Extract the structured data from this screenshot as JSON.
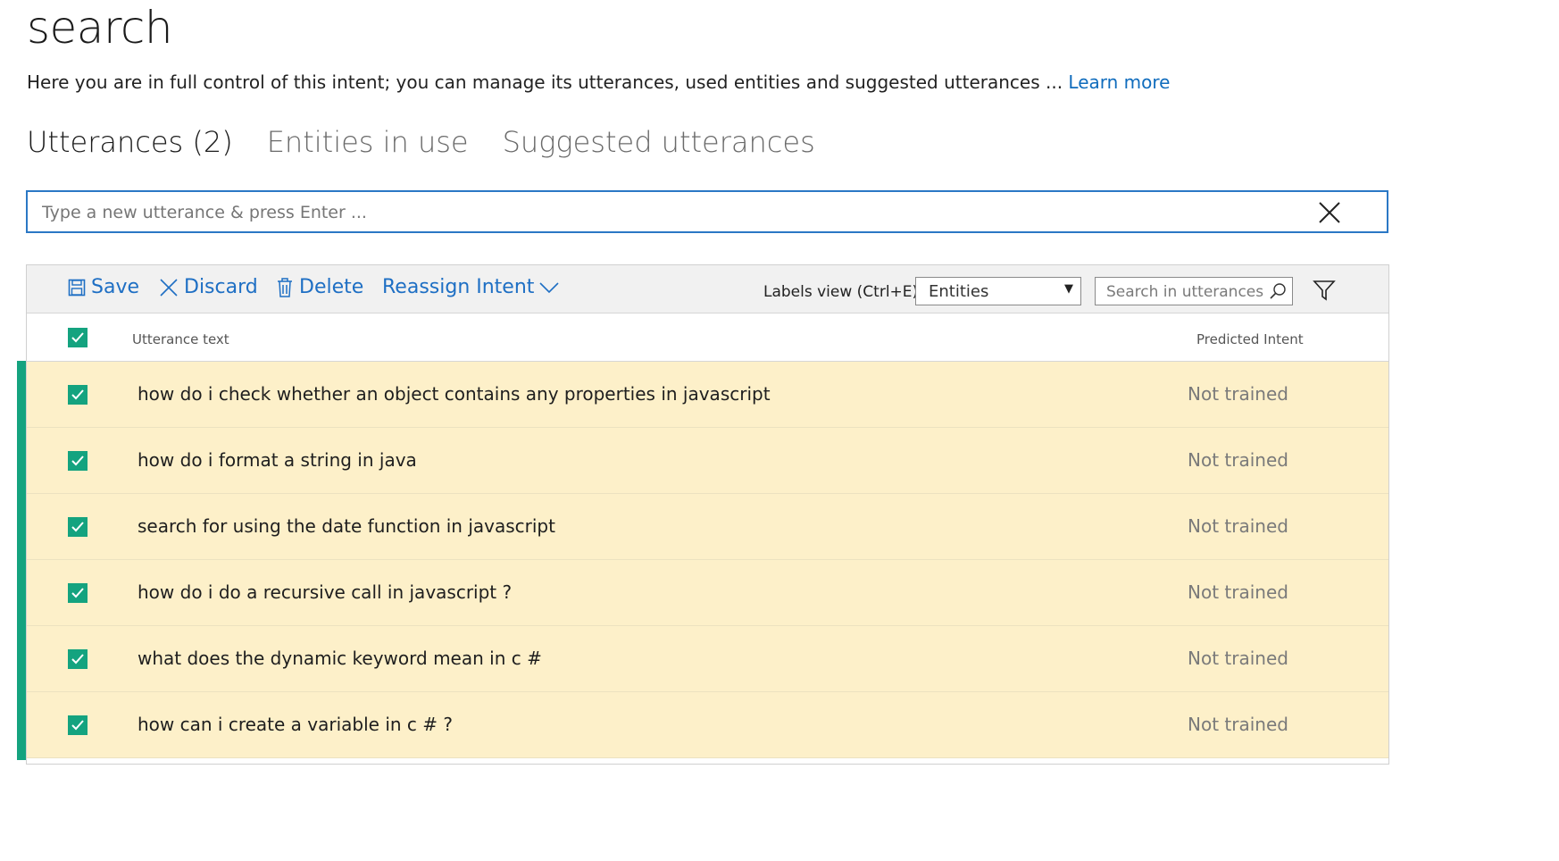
{
  "page": {
    "title": "search",
    "description": "Here you are in full control of this intent; you can manage its utterances, used entities and suggested utterances ...",
    "learn_more": "Learn more"
  },
  "tabs": [
    {
      "label": "Utterances (2)",
      "active": true
    },
    {
      "label": "Entities in use",
      "active": false
    },
    {
      "label": "Suggested utterances",
      "active": false
    }
  ],
  "new_utterance": {
    "placeholder": "Type a new utterance & press Enter ...",
    "value": ""
  },
  "toolbar": {
    "save": "Save",
    "discard": "Discard",
    "delete": "Delete",
    "reassign": "Reassign Intent",
    "labels_view_label": "Labels view (Ctrl+E):",
    "labels_view_value": "Entities",
    "search_placeholder": "Search in utterances ..."
  },
  "table": {
    "col_text": "Utterance text",
    "col_intent": "Predicted Intent",
    "rows": [
      {
        "text": "how do i check whether an object contains any properties in javascript",
        "intent": "Not trained",
        "checked": true
      },
      {
        "text": "how do i format a string in java",
        "intent": "Not trained",
        "checked": true
      },
      {
        "text": "search for using the date function in javascript",
        "intent": "Not trained",
        "checked": true
      },
      {
        "text": "how do i do a recursive call in javascript ?",
        "intent": "Not trained",
        "checked": true
      },
      {
        "text": "what does the dynamic keyword mean in c #",
        "intent": "Not trained",
        "checked": true
      },
      {
        "text": "how can i create a variable in c # ?",
        "intent": "Not trained",
        "checked": true
      }
    ]
  },
  "colors": {
    "accent": "#1e6fc4",
    "selected_green": "#14a37f",
    "row_highlight": "#fdf0c9"
  }
}
